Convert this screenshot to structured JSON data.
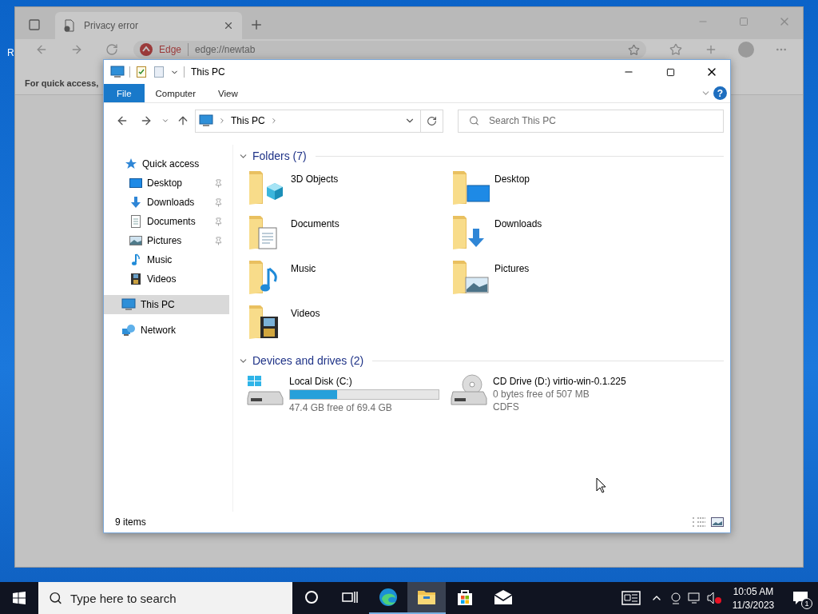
{
  "desktop": {
    "icon_label": "R"
  },
  "browser": {
    "tab": {
      "title": "Privacy error",
      "selected": true
    },
    "address": {
      "site": "Edge",
      "url": "edge://newtab"
    },
    "favorites_bar": "For quick access,"
  },
  "explorer": {
    "title": "This PC",
    "ribbon_tabs": [
      {
        "label": "File",
        "selected": true
      },
      {
        "label": "Computer",
        "selected": false
      },
      {
        "label": "View",
        "selected": false
      }
    ],
    "help_label": "?",
    "path": [
      "This PC"
    ],
    "search": {
      "placeholder": "Search This PC"
    },
    "nav": [
      {
        "label": "Quick access",
        "kind": "star",
        "selected": false,
        "children": [
          {
            "label": "Desktop",
            "kind": "desktop",
            "pinned": true,
            "selected": false
          },
          {
            "label": "Downloads",
            "kind": "downloads",
            "pinned": true,
            "selected": false
          },
          {
            "label": "Documents",
            "kind": "documents",
            "pinned": true,
            "selected": false
          },
          {
            "label": "Pictures",
            "kind": "pictures",
            "pinned": true,
            "selected": false
          },
          {
            "label": "Music",
            "kind": "music",
            "pinned": false,
            "selected": false
          },
          {
            "label": "Videos",
            "kind": "videos",
            "pinned": false,
            "selected": false
          }
        ]
      },
      {
        "label": "This PC",
        "kind": "pc",
        "selected": true
      },
      {
        "label": "Network",
        "kind": "network",
        "selected": false
      }
    ],
    "folders": {
      "title": "Folders (7)",
      "expanded": true,
      "items": [
        {
          "name": "3D Objects",
          "kind": "objects"
        },
        {
          "name": "Desktop",
          "kind": "desktop"
        },
        {
          "name": "Documents",
          "kind": "documents"
        },
        {
          "name": "Downloads",
          "kind": "downloads"
        },
        {
          "name": "Music",
          "kind": "music"
        },
        {
          "name": "Pictures",
          "kind": "pictures"
        },
        {
          "name": "Videos",
          "kind": "videos"
        }
      ]
    },
    "drives": {
      "title": "Devices and drives (2)",
      "expanded": true,
      "items": [
        {
          "name": "Local Disk (C:)",
          "kind": "disk",
          "level": 0.317,
          "detail": "47.4 GB free of 69.4 GB"
        },
        {
          "name": "CD Drive (D:) virtio-win-0.1.225",
          "kind": "cd",
          "detail": "0 bytes free of 507 MB",
          "filesystem": "CDFS"
        }
      ]
    },
    "status_bar": {
      "count": "9 items"
    }
  },
  "taskbar": {
    "search_placeholder": "Type here to search",
    "apps": [
      {
        "kind": "edge",
        "selected": false,
        "running": true
      },
      {
        "kind": "explorer",
        "selected": true,
        "running": true
      },
      {
        "kind": "store",
        "selected": false,
        "running": false
      },
      {
        "kind": "mail",
        "selected": false,
        "running": false
      }
    ],
    "time": "10:05 AM",
    "date": "11/3/2023",
    "notification_count": "1"
  }
}
